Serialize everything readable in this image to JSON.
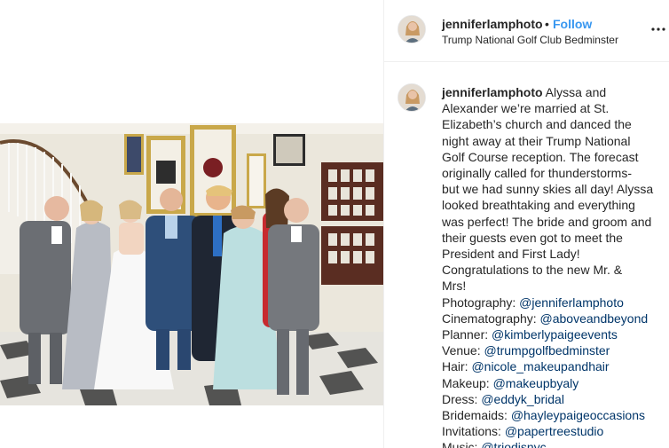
{
  "post": {
    "username": "jenniferlamphoto",
    "follow_label": "Follow",
    "separator": "•",
    "location": "Trump National Golf Club Bedminster",
    "more_icon": "more-horizontal-icon"
  },
  "comment": {
    "username": "jenniferlamphoto",
    "caption_lines": [
      " Alyssa and",
      "Alexander we’re married at St.",
      "Elizabeth’s church and danced the",
      "night away at their Trump National",
      "Golf Course reception. The forecast",
      "originally called for thunderstorms-",
      "but we had sunny skies all day! Alyssa",
      "looked breathtaking and everything",
      "was perfect! The bride and groom and",
      "their guests even got to meet the",
      "President and First Lady!",
      "Congratulations to the new Mr. &",
      "Mrs!"
    ],
    "credits": [
      {
        "role": "Photography: ",
        "handle": "@jenniferlamphoto"
      },
      {
        "role": "Cinematography: ",
        "handle": "@aboveandbeyond"
      },
      {
        "role": "Planner: ",
        "handle": "@kimberlypaigeevents"
      },
      {
        "role": "Venue: ",
        "handle": "@trumpgolfbedminster"
      },
      {
        "role": "Hair: ",
        "handle": "@nicole_makeupandhair"
      },
      {
        "role": "Makeup: ",
        "handle": "@makeupbyaly"
      },
      {
        "role": "Dress: ",
        "handle": "@eddyk_bridal"
      },
      {
        "role": "Bridemaids: ",
        "handle": "@hayleypaigeoccasions"
      },
      {
        "role": "Invitations: ",
        "handle": "@papertreestudio"
      },
      {
        "role": "Music: ",
        "handle": "@triodjsnyc"
      }
    ]
  },
  "colors": {
    "link": "#003569",
    "follow": "#3897f0",
    "text": "#262626",
    "border": "#efefef"
  }
}
